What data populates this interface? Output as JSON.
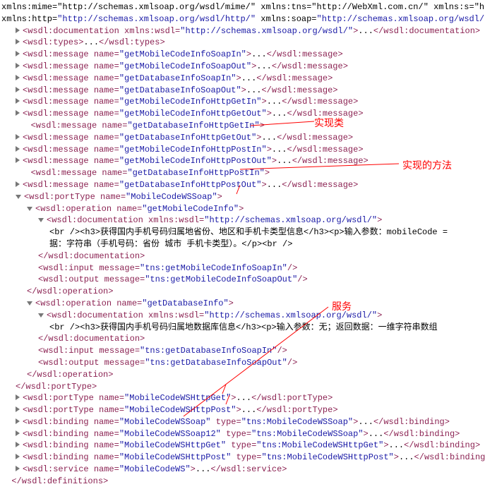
{
  "header": {
    "line1": "xmlns:mime=\"http://schemas.xmlsoap.org/wsdl/mime/\" xmlns:tns=\"http://WebXml.com.cn/\" xmlns:s=\"ht",
    "line2_prefix": "xmlns:http=",
    "line2_val": "\"http://schemas.xmlsoap.org/wsdl/http/\"",
    "line2_mid": " xmlns:soap=",
    "line2_val2": "\"http://schemas.xmlsoap.org/wsdl/\""
  },
  "doc": {
    "open": "<wsdl:documentation",
    "attr": " xmlns:wsdl=",
    "val": "\"http://schemas.xmlsoap.org/wsdl/\"",
    "close": "</wsdl:documentation>"
  },
  "types": {
    "open": "<wsdl:types>",
    "close": "</wsdl:types>"
  },
  "msg_tag": "<wsdl:message",
  "msg_close": "</wsdl:message>",
  "name_attr": " name=",
  "messages": [
    "\"getMobileCodeInfoSoapIn\"",
    "\"getMobileCodeInfoSoapOut\"",
    "\"getDatabaseInfoSoapIn\"",
    "\"getDatabaseInfoSoapOut\"",
    "\"getMobileCodeInfoHttpGetIn\"",
    "\"getMobileCodeInfoHttpGetOut\"",
    "\"getDatabaseInfoHttpGetIn\"",
    "\"getDatabaseInfoHttpGetOut\"",
    "\"getMobileCodeInfoHttpPostIn\"",
    "\"getMobileCodeInfoHttpPostOut\"",
    "\"getDatabaseInfoHttpPostIn\"",
    "\"getDatabaseInfoHttpPostOut\""
  ],
  "pt": {
    "open": "<wsdl:portType",
    "close": "</wsdl:portType>",
    "name1": "\"MobileCodeWSSoap\"",
    "name2": "\"MobileCodeWSHttpGet\"",
    "name3": "\"MobileCodeWSHttpPost\""
  },
  "op": {
    "open": "<wsdl:operation",
    "close": "</wsdl:operation>",
    "name1": "\"getMobileCodeInfo\"",
    "name2": "\"getDatabaseInfo\""
  },
  "docinner": {
    "open": "<wsdl:documentation",
    "attr": " xmlns:wsdl=",
    "val": "\"http://schemas.xmlsoap.org/wsdl/\"",
    "close": "</wsdl:documentation>"
  },
  "desc1a": "<br /><h3>获得国内手机号码归属地省份、地区和手机卡类型信息</h3><p>输入参数：mobileCode = ",
  "desc1b": "据：字符串（手机号码：省份 城市 手机卡类型）。</p><br />",
  "desc2": "<br /><h3>获得国内手机号码归属地数据库信息</h3><p>输入参数：无；返回数据：一维字符串数组",
  "input": {
    "open": "<wsdl:input",
    "attr": " message=",
    "v1": "\"tns:getMobileCodeInfoSoapIn\"",
    "v2": "\"tns:getDatabaseInfoSoapIn\"",
    "end": "/>"
  },
  "output": {
    "open": "<wsdl:output",
    "attr": " message=",
    "v1": "\"tns:getMobileCodeInfoSoapOut\"",
    "v2": "\"tns:getDatabaseInfoSoapOut\"",
    "end": "/>"
  },
  "bind": {
    "open": "<wsdl:binding",
    "close": "</wsdl:binding>",
    "type_attr": " type=",
    "n1": "\"MobileCodeWSSoap\"",
    "t1": "\"tns:MobileCodeWSSoap\"",
    "n2": "\"MobileCodeWSSoap12\"",
    "t2": "\"tns:MobileCodeWSSoap\"",
    "n3": "\"MobileCodeWSHttpGet\"",
    "t3": "\"tns:MobileCodeWSHttpGet\"",
    "n4": "\"MobileCodeWSHttpPost\"",
    "t4": "\"tns:MobileCodeWSHttpPost\""
  },
  "svc": {
    "open": "<wsdl:service",
    "name": "\"MobileCodeWS\"",
    "close": "</wsdl:service>"
  },
  "def_close": "</wsdl:definitions>",
  "dots": "...",
  "gt": ">",
  "anno": {
    "a1": "实现类",
    "a2": "实现的方法",
    "a3": "服务"
  }
}
